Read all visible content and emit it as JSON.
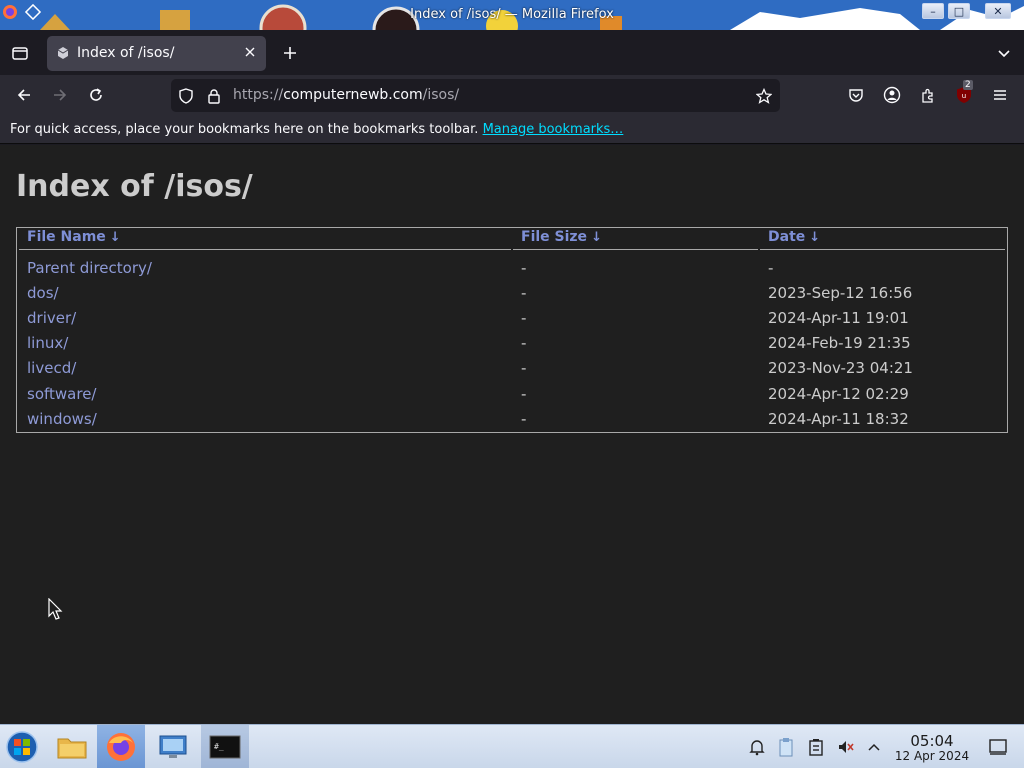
{
  "window": {
    "title": "Index of /isos/ — Mozilla Firefox",
    "minimize_glyph": "–",
    "maximize_glyph": "□",
    "close_glyph": "✕"
  },
  "tab": {
    "title": "Index of /isos/",
    "favicon": "directory-icon"
  },
  "address_bar": {
    "url_prefix": "https://",
    "url_host": "computernewb.com",
    "url_path": "/isos/"
  },
  "toolbar": {
    "extensions_badge": "2"
  },
  "bookmarks_bar": {
    "message": "For quick access, place your bookmarks here on the bookmarks toolbar.",
    "manage_link": "Manage bookmarks…"
  },
  "page": {
    "heading": "Index of /isos/",
    "columns": [
      {
        "label": "File Name",
        "arrow": "↓"
      },
      {
        "label": "File Size",
        "arrow": "↓"
      },
      {
        "label": "Date",
        "arrow": "↓"
      }
    ],
    "rows": [
      {
        "name": "Parent directory/",
        "size": "-",
        "date": "-"
      },
      {
        "name": "dos/",
        "size": "-",
        "date": "2023-Sep-12 16:56"
      },
      {
        "name": "driver/",
        "size": "-",
        "date": "2024-Apr-11 19:01"
      },
      {
        "name": "linux/",
        "size": "-",
        "date": "2024-Feb-19 21:35"
      },
      {
        "name": "livecd/",
        "size": "-",
        "date": "2023-Nov-23 04:21"
      },
      {
        "name": "software/",
        "size": "-",
        "date": "2024-Apr-12 02:29"
      },
      {
        "name": "windows/",
        "size": "-",
        "date": "2024-Apr-11 18:32"
      }
    ]
  },
  "taskbar": {
    "clock_time": "05:04",
    "clock_date": "12 Apr 2024"
  },
  "colors": {
    "accent_link": "#00ddff",
    "listing_link": "#8e9ad6",
    "header_link": "#7e8fd6"
  }
}
